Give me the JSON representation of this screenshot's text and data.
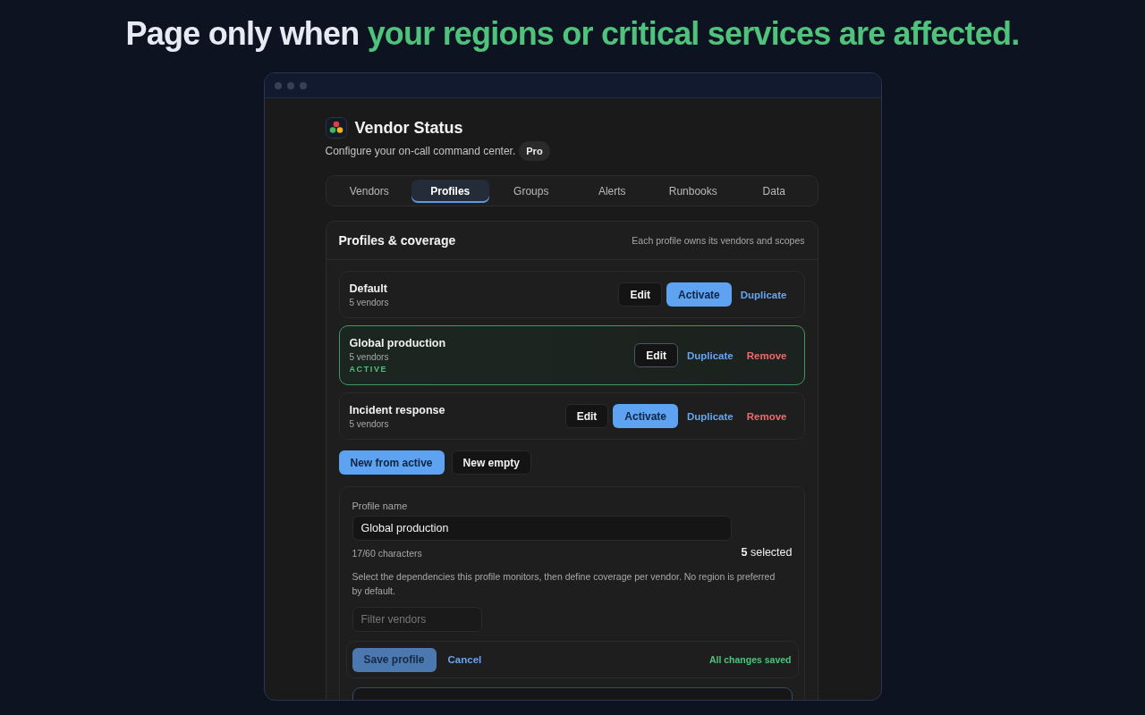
{
  "headline": {
    "lead": "Page only when",
    "highlight": "your regions or critical services are affected."
  },
  "app": {
    "title": "Vendor Status",
    "subtitle": "Configure your on-call command center.",
    "plan_badge": "Pro",
    "tabs": [
      {
        "label": "Vendors",
        "selected": false
      },
      {
        "label": "Profiles",
        "selected": true
      },
      {
        "label": "Groups",
        "selected": false
      },
      {
        "label": "Alerts",
        "selected": false
      },
      {
        "label": "Runbooks",
        "selected": false
      },
      {
        "label": "Data",
        "selected": false
      }
    ],
    "panel": {
      "title": "Profiles & coverage",
      "note": "Each profile owns its vendors and scopes",
      "profiles": [
        {
          "name": "Default",
          "count": "5 vendors",
          "active": false,
          "actions": [
            {
              "kind": "edit",
              "label": "Edit"
            },
            {
              "kind": "activate",
              "label": "Activate"
            },
            {
              "kind": "duplicate",
              "label": "Duplicate"
            }
          ]
        },
        {
          "name": "Global production",
          "count": "5 vendors",
          "active": true,
          "status": "ACTIVE",
          "actions": [
            {
              "kind": "edit",
              "label": "Edit"
            },
            {
              "kind": "duplicate",
              "label": "Duplicate"
            },
            {
              "kind": "remove",
              "label": "Remove"
            }
          ]
        },
        {
          "name": "Incident response",
          "count": "5 vendors",
          "active": false,
          "actions": [
            {
              "kind": "edit",
              "label": "Edit"
            },
            {
              "kind": "activate",
              "label": "Activate"
            },
            {
              "kind": "duplicate",
              "label": "Duplicate"
            },
            {
              "kind": "remove",
              "label": "Remove"
            }
          ]
        }
      ],
      "create_buttons": [
        {
          "kind": "primary",
          "label": "New from active"
        },
        {
          "kind": "secondary",
          "label": "New empty"
        }
      ],
      "editor": {
        "name_label": "Profile name",
        "name_value": "Global production",
        "char_count": "17/60 characters",
        "selected_count": "**5** selected",
        "help": "Select the dependencies this profile monitors, then define coverage per vendor. No region is preferred by default.",
        "filter": {
          "placeholder": "Filter vendors"
        },
        "save_bar": {
          "save": {
            "label": "Save profile",
            "disabled": true
          },
          "cancel": "Cancel",
          "status": "All changes saved"
        }
      }
    }
  }
}
